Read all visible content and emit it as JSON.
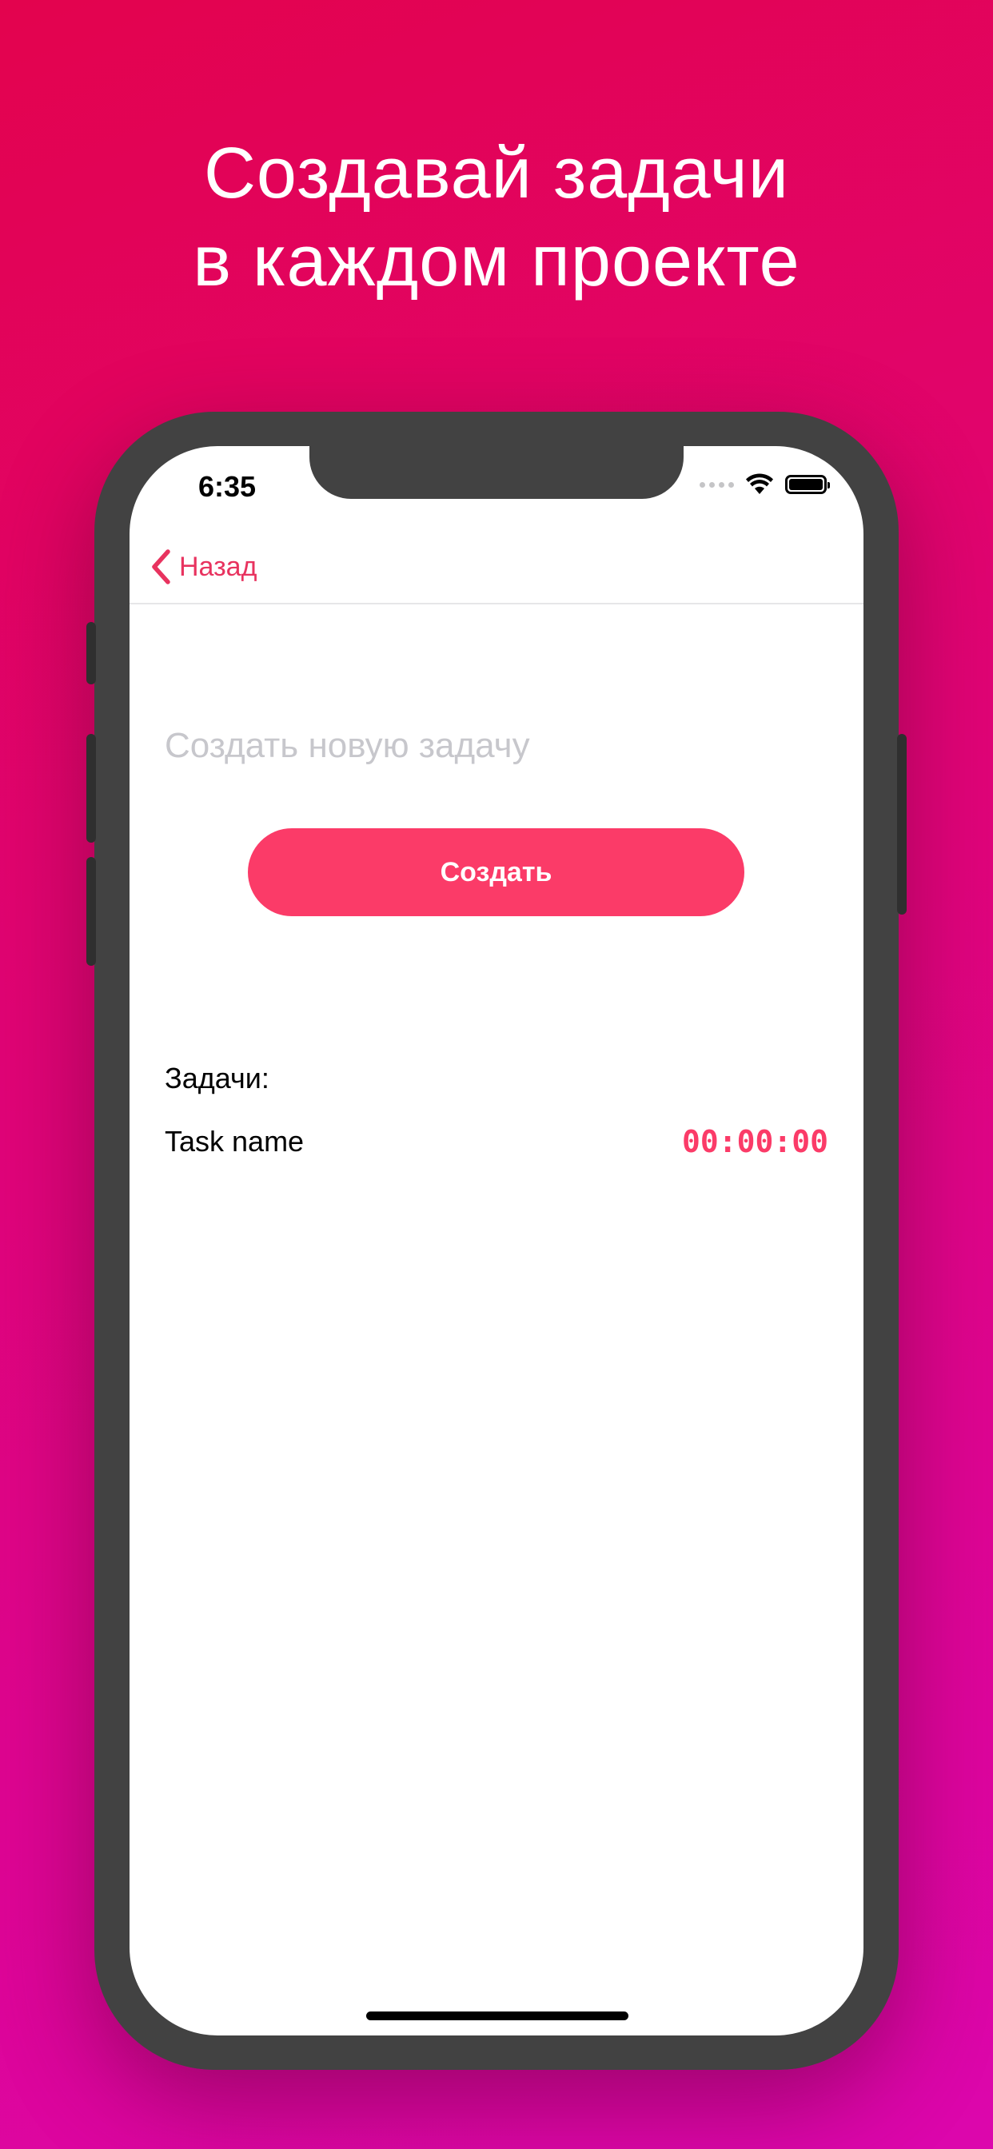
{
  "headline": {
    "line1": "Создавай задачи",
    "line2": "в каждом проекте"
  },
  "status_bar": {
    "time": "6:35",
    "icons": [
      "signal-icon",
      "wifi-icon",
      "battery-icon"
    ]
  },
  "navbar": {
    "back_label": "Назад",
    "back_icon": "chevron-left-icon"
  },
  "task_input": {
    "value": "",
    "placeholder": "Создать новую задачу"
  },
  "create_button": {
    "label": "Создать"
  },
  "tasks": {
    "label": "Задачи:",
    "items": [
      {
        "name": "Task name",
        "time": "00:00:00"
      }
    ]
  },
  "colors": {
    "accent": "#fb3b68",
    "nav_accent": "#e8335f",
    "background_top": "#e3034e",
    "background_bottom": "#dc06ad",
    "phone_frame": "#424242"
  }
}
